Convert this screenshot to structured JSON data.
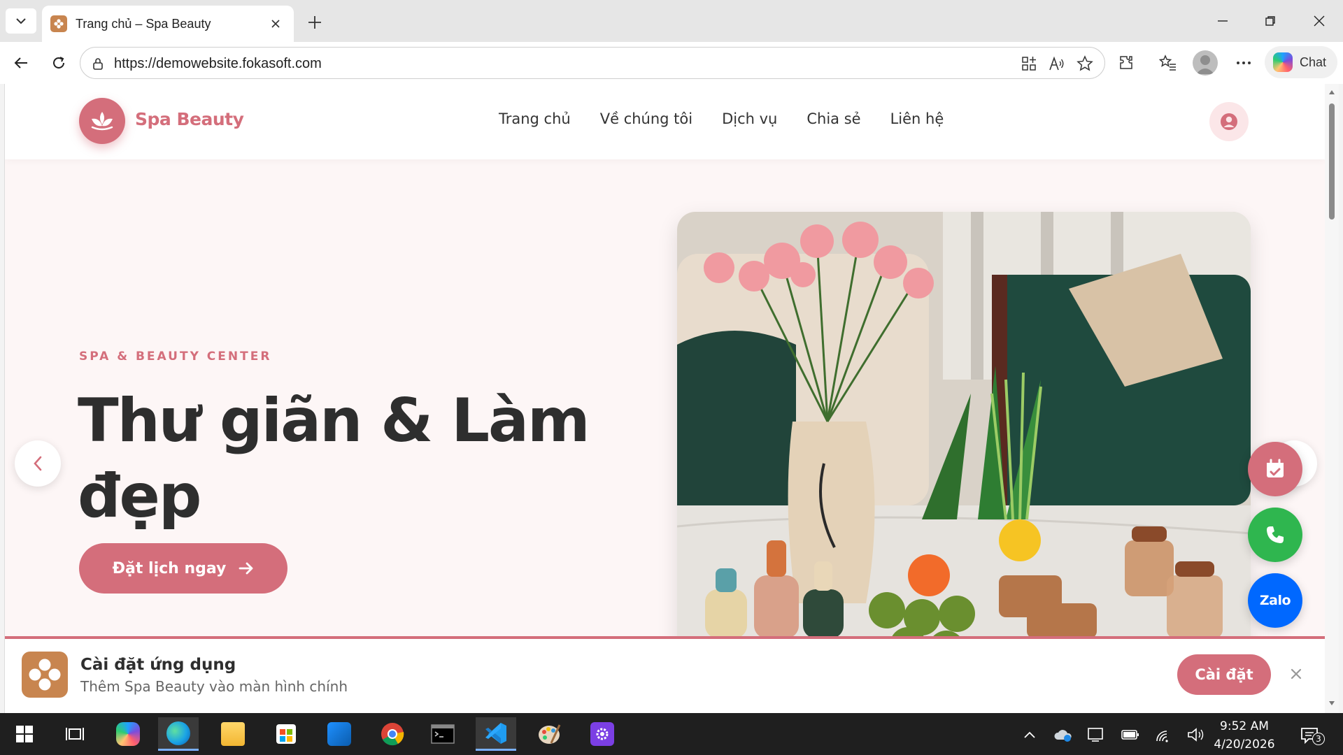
{
  "browser": {
    "tab_title": "Trang chủ – Spa Beauty",
    "url": "https://demowebsite.fokasoft.com",
    "copilot_label": "Chat"
  },
  "site": {
    "brand": "Spa Beauty",
    "nav": [
      "Trang chủ",
      "Về chúng tôi",
      "Dịch vụ",
      "Chia sẻ",
      "Liên hệ"
    ],
    "hero": {
      "eyebrow": "SPA & BEAUTY CENTER",
      "title": "Thư giãn & Làm đẹp",
      "cta_label": "Đặt lịch ngay"
    },
    "floating": {
      "zalo_label": "Zalo"
    },
    "install_banner": {
      "title": "Cài đặt ứng dụng",
      "subtitle": "Thêm Spa Beauty vào màn hình chính",
      "button_label": "Cài đặt"
    }
  },
  "taskbar": {
    "time": "9:52 AM",
    "date": "4/20/2026",
    "notification_count": "3"
  },
  "colors": {
    "brand": "#d46e7b",
    "heading": "#2e2e2e",
    "page_bg": "#fdf6f6",
    "call_green": "#2fb64f",
    "zalo_blue": "#0068ff"
  },
  "icons": [
    "tab-list-icon",
    "close-icon",
    "plus-icon",
    "minimize-icon",
    "restore-icon",
    "back-icon",
    "refresh-icon",
    "lock-icon",
    "apps-icon",
    "read-aloud-icon",
    "favorite-icon",
    "extensions-icon",
    "favorites-icon",
    "more-icon",
    "lotus-icon",
    "user-icon",
    "arrow-right-icon",
    "chevron-left-icon",
    "calendar-icon",
    "phone-icon",
    "windows-icon"
  ]
}
